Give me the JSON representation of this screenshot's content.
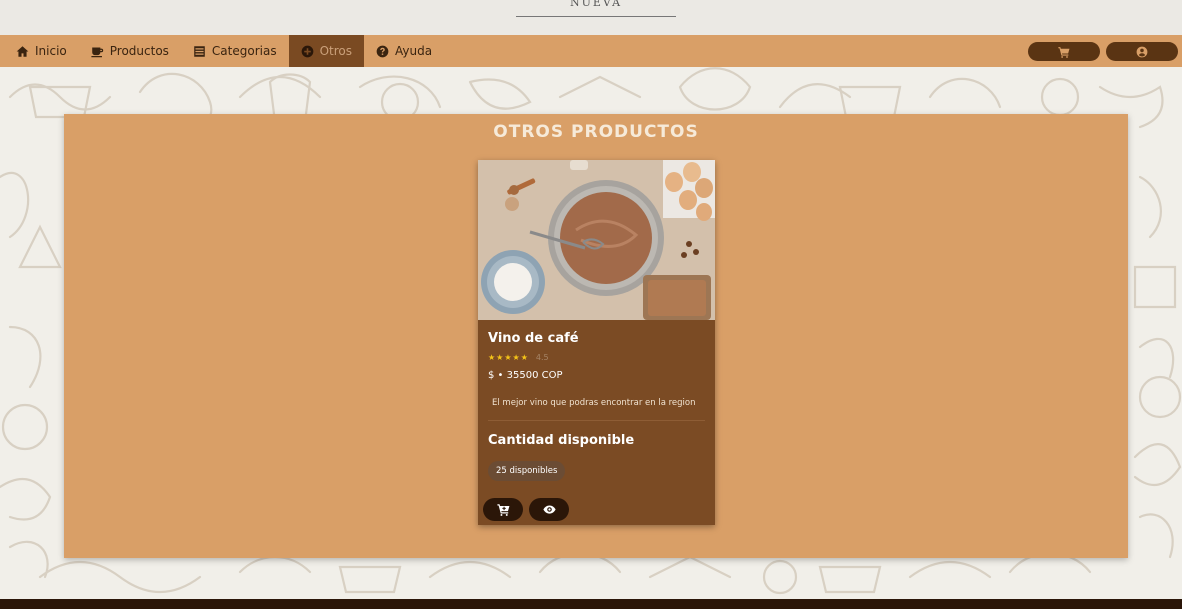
{
  "brand": {
    "text": "NUEVA"
  },
  "nav": {
    "items": [
      {
        "label": "Inicio",
        "icon": "home-icon"
      },
      {
        "label": "Productos",
        "icon": "coffee-cup-icon"
      },
      {
        "label": "Categorias",
        "icon": "list-icon"
      },
      {
        "label": "Otros",
        "icon": "plus-circle-icon",
        "active": true
      },
      {
        "label": "Ayuda",
        "icon": "question-circle-icon"
      }
    ],
    "cart_icon": "cart-icon",
    "user_icon": "user-circle-icon"
  },
  "section": {
    "title": "OTROS PRODUCTOS"
  },
  "product": {
    "name": "Vino de café",
    "rating": 4.5,
    "rating_label": "4.5",
    "price": "$ • 35500 COP",
    "description": "El mejor vino que podras encontrar en la region",
    "stock_heading": "Cantidad disponible",
    "stock_badge": "25 disponibles",
    "add_to_cart_icon": "cart-plus-icon",
    "view_icon": "eye-icon"
  },
  "colors": {
    "navbar": "#d99f67",
    "panel": "#d99f67",
    "card": "#7b4b24",
    "button": "#2b1608",
    "star": "#f5c518"
  }
}
